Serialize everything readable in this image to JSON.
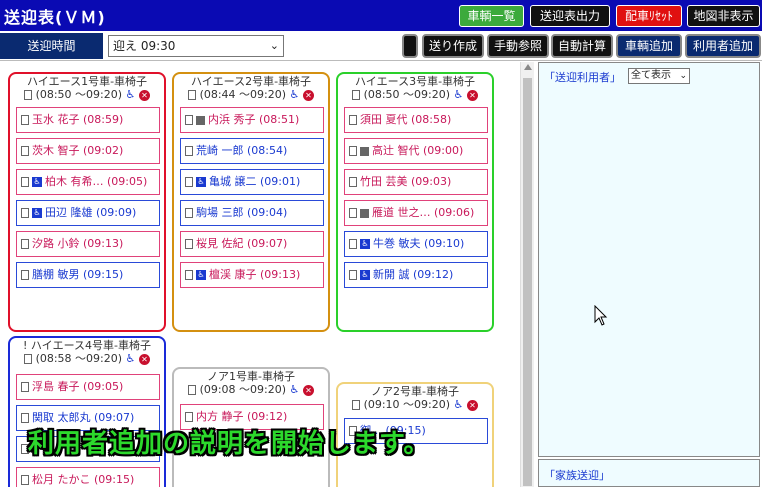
{
  "app": {
    "title": "送迎表(ＶＭ)"
  },
  "top_buttons": [
    {
      "label": "車輌一覧",
      "color": "green"
    },
    {
      "label": "送迎表出力",
      "color": "black"
    },
    {
      "label": "配車ﾘｾｯﾄ",
      "color": "red"
    },
    {
      "label": "地図非表示",
      "color": "black"
    }
  ],
  "subbar": {
    "time_label": "送迎時間",
    "time_select": "迎え 09:30",
    "buttons": [
      "",
      "送り作成",
      "手動参照",
      "自動計算",
      "車輌追加",
      "利用者追加"
    ]
  },
  "vehicles": [
    {
      "name": "ハイエース1号車-車椅子",
      "time": "(08:50 ～09:20)",
      "color": "#e0102a",
      "passengers": [
        {
          "name": "玉水 花子 (08:59)",
          "style": "pink",
          "icon": ""
        },
        {
          "name": "茨木 智子 (09:02)",
          "style": "pink",
          "icon": ""
        },
        {
          "name": "柏木 有希… (09:05)",
          "style": "pink",
          "icon": "wheelchair"
        },
        {
          "name": "田辺 隆雄 (09:09)",
          "style": "blue",
          "icon": "wheelchair"
        },
        {
          "name": "汐路 小鈴 (09:13)",
          "style": "pink",
          "icon": ""
        },
        {
          "name": "膳棚 敏男 (09:15)",
          "style": "blue",
          "icon": ""
        }
      ]
    },
    {
      "name": "ハイエース2号車-車椅子",
      "time": "(08:44 ～09:20)",
      "color": "#d49010",
      "passengers": [
        {
          "name": "内浜 秀子 (08:51)",
          "style": "pink",
          "icon": "grid"
        },
        {
          "name": "荒崎 一郎 (08:54)",
          "style": "blue",
          "icon": ""
        },
        {
          "name": "亀城 譲二 (09:01)",
          "style": "blue",
          "icon": "wheelchair"
        },
        {
          "name": "駒場 三郎 (09:04)",
          "style": "blue",
          "icon": ""
        },
        {
          "name": "桜見 佐紀 (09:07)",
          "style": "pink",
          "icon": ""
        },
        {
          "name": "檀渓 康子 (09:13)",
          "style": "pink",
          "icon": "wheelchair"
        }
      ]
    },
    {
      "name": "ハイエース3号車-車椅子",
      "time": "(08:50 ～09:20)",
      "color": "#2ad02a",
      "passengers": [
        {
          "name": "須田 夏代 (08:58)",
          "style": "pink",
          "icon": ""
        },
        {
          "name": "高辻 智代 (09:00)",
          "style": "pink",
          "icon": "grid"
        },
        {
          "name": "竹田 芸美 (09:03)",
          "style": "pink",
          "icon": ""
        },
        {
          "name": "雁道 世之… (09:06)",
          "style": "pink",
          "icon": "grid"
        },
        {
          "name": "牛巻 敏夫 (09:10)",
          "style": "blue",
          "icon": "wheelchair"
        },
        {
          "name": "新開 誠 (09:12)",
          "style": "blue",
          "icon": "wheelchair"
        }
      ]
    },
    {
      "name": "ハイエース4号車-車椅子",
      "time": "(08:58 ～09:20)",
      "color": "#1a2ad8",
      "alert": "!",
      "passengers": [
        {
          "name": "浮島 春子 (09:05)",
          "style": "pink",
          "icon": ""
        },
        {
          "name": "関取 太郎丸 (09:07)",
          "style": "blue",
          "icon": ""
        },
        {
          "name": "",
          "style": "blue",
          "icon": ""
        },
        {
          "name": "松月 たかこ (09:15)",
          "style": "pink",
          "icon": ""
        }
      ]
    },
    {
      "name": "ノア1号車-車椅子",
      "time": "(09:08 ～09:20)",
      "color": "#bbbbbb",
      "passengers": [
        {
          "name": "内方 静子 (09:12)",
          "style": "pink",
          "icon": ""
        }
      ]
    },
    {
      "name": "ノア2号車-車椅子",
      "time": "(09:10 ～09:20)",
      "color": "#f0d27a",
      "passengers": [
        {
          "name": "御… (09:15)",
          "style": "blue",
          "icon": ""
        }
      ]
    }
  ],
  "right_panel": {
    "label": "「送迎利用者」",
    "select": "全て表示",
    "bottom_label": "「家族送迎」"
  },
  "caption": "利用者追加の説明を開始します。"
}
